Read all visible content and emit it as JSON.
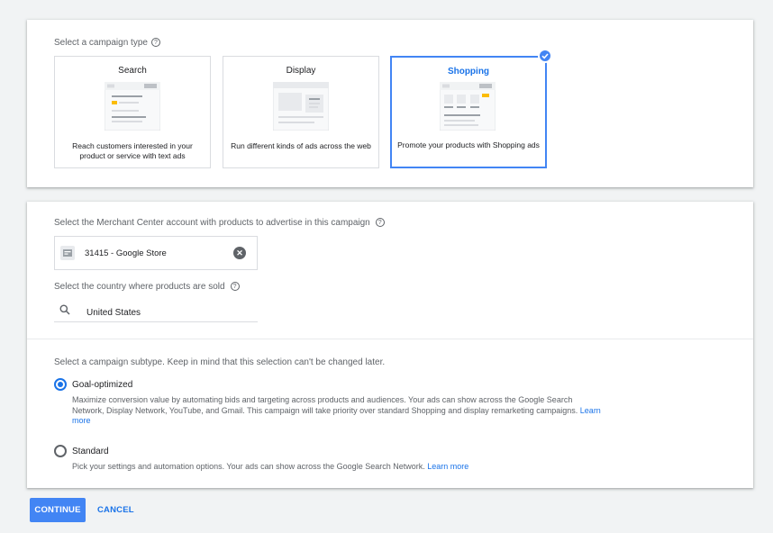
{
  "campaign_type": {
    "prompt": "Select a campaign type",
    "options": [
      {
        "title": "Search",
        "description": "Reach customers interested in your product or service with text ads",
        "selected": false
      },
      {
        "title": "Display",
        "description": "Run different kinds of ads across the web",
        "selected": false
      },
      {
        "title": "Shopping",
        "description": "Promote your products with Shopping ads",
        "selected": true
      }
    ]
  },
  "merchant": {
    "prompt": "Select the Merchant Center account with products to advertise in this campaign",
    "account_label": "31415 - Google Store",
    "country_prompt": "Select the country where products are sold",
    "country_value": "United States"
  },
  "subtype": {
    "prompt": "Select a campaign subtype. Keep in mind that this selection can't be changed later.",
    "options": [
      {
        "title": "Goal-optimized",
        "description": "Maximize conversion value by automating bids and targeting across products and audiences. Your ads can show across the Google Search Network, Display Network, YouTube, and Gmail. This campaign will take priority over standard Shopping and display remarketing campaigns.",
        "link": "Learn more",
        "selected": true
      },
      {
        "title": "Standard",
        "description": "Pick your settings and automation options. Your ads can show across the Google Search Network.",
        "link": "Learn more",
        "selected": false
      }
    ]
  },
  "actions": {
    "continue_label": "CONTINUE",
    "cancel_label": "CANCEL"
  },
  "colors": {
    "accent": "#1a73e8",
    "button": "#4285f4",
    "background": "#f1f3f4"
  }
}
